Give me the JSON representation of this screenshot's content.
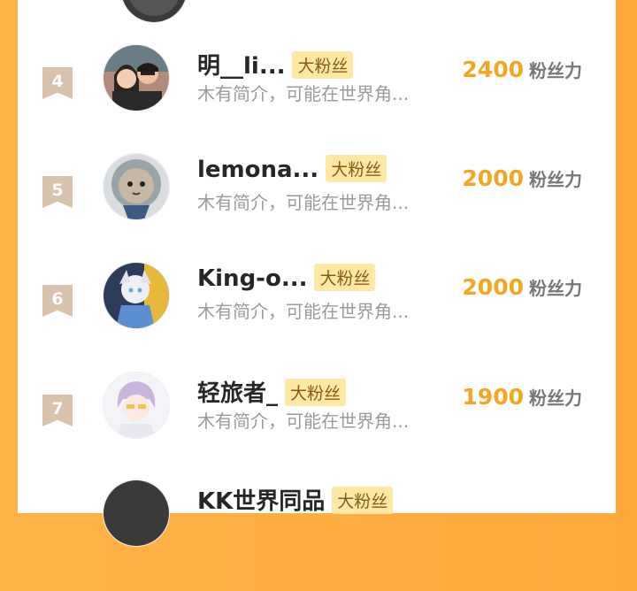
{
  "rows": [
    {
      "rank": "4",
      "name": "明__li...",
      "badge": "大粉丝",
      "desc": "木有简介，可能在世界角...",
      "score": "2400",
      "unit": "粉丝力"
    },
    {
      "rank": "5",
      "name": "lemona...",
      "badge": "大粉丝",
      "desc": "木有简介，可能在世界角...",
      "score": "2000",
      "unit": "粉丝力"
    },
    {
      "rank": "6",
      "name": "King-o...",
      "badge": "大粉丝",
      "desc": "木有简介，可能在世界角...",
      "score": "2000",
      "unit": "粉丝力"
    },
    {
      "rank": "7",
      "name": "轻旅者_",
      "badge": "大粉丝",
      "desc": "木有简介，可能在世界角...",
      "score": "1900",
      "unit": "粉丝力"
    },
    {
      "name": "KK世界同品",
      "badge": "大粉丝"
    }
  ]
}
